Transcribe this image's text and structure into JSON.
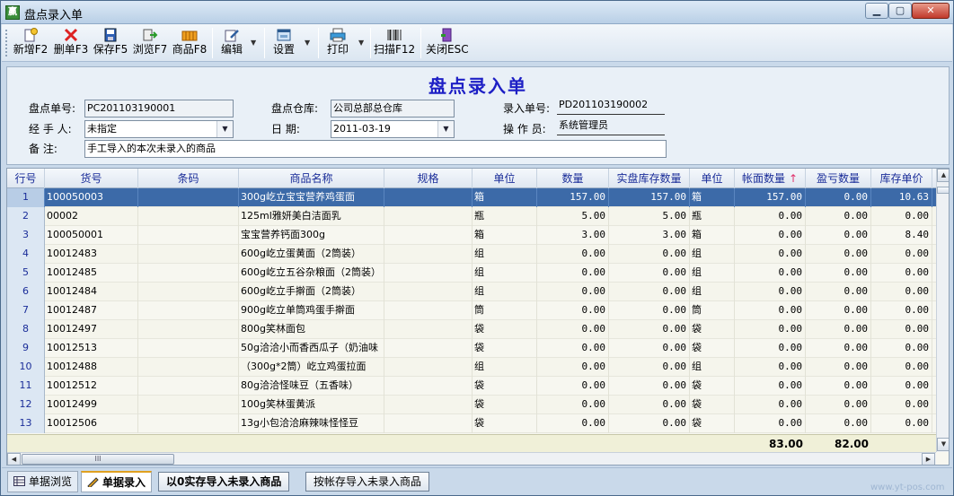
{
  "window": {
    "title": "盘点录入单",
    "icon_text": "赢"
  },
  "toolbar": [
    {
      "name": "add",
      "label": "新增F2",
      "icon": "new-doc-icon"
    },
    {
      "name": "delete",
      "label": "删单F3",
      "icon": "delete-x-icon"
    },
    {
      "name": "save",
      "label": "保存F5",
      "icon": "save-disk-icon"
    },
    {
      "name": "browse",
      "label": "浏览F7",
      "icon": "browse-arrow-icon"
    },
    {
      "name": "product",
      "label": "商品F8",
      "icon": "product-box-icon"
    },
    {
      "name": "edit",
      "label": "编辑",
      "icon": "edit-pen-icon"
    },
    {
      "name": "settings",
      "label": "设置",
      "icon": "settings-window-icon"
    },
    {
      "name": "print",
      "label": "打印",
      "icon": "printer-icon"
    },
    {
      "name": "scan",
      "label": "扫描F12",
      "icon": "barcode-icon"
    },
    {
      "name": "close",
      "label": "关闭ESC",
      "icon": "close-door-icon"
    }
  ],
  "form": {
    "title": "盘点录入单",
    "doc_no_label": "盘点单号:",
    "doc_no": "PC201103190001",
    "handler_label": "经 手 人:",
    "handler": "未指定",
    "note_label": "备    注:",
    "note": "手工导入的本次未录入的商品",
    "warehouse_label": "盘点仓库:",
    "warehouse": "公司总部总仓库",
    "date_label": "日    期:",
    "date": "2011-03-19",
    "entry_no_label": "录入单号:",
    "entry_no": "PD201103190002",
    "operator_label": "操 作 员:",
    "operator": "系统管理员"
  },
  "grid": {
    "columns": [
      "行号",
      "货号",
      "条码",
      "商品名称",
      "规格",
      "单位",
      "数量",
      "实盘库存数量",
      "单位",
      "帐面数量",
      "盈亏数量",
      "库存单价"
    ],
    "sort_indicator": "↑",
    "rows": [
      {
        "no": "1",
        "code": "100050003",
        "barcode": "",
        "name": "300g屹立宝宝营养鸡蛋面",
        "spec": "",
        "unit": "箱",
        "qty": "157.00",
        "actual": "157.00",
        "unit2": "箱",
        "book": "157.00",
        "diff": "0.00",
        "price": "10.63"
      },
      {
        "no": "2",
        "code": "00002",
        "barcode": "",
        "name": "125ml雅妍美白洁面乳",
        "spec": "",
        "unit": "瓶",
        "qty": "5.00",
        "actual": "5.00",
        "unit2": "瓶",
        "book": "0.00",
        "diff": "0.00",
        "price": "0.00"
      },
      {
        "no": "3",
        "code": "100050001",
        "barcode": "",
        "name": "宝宝营养钙面300g",
        "spec": "",
        "unit": "箱",
        "qty": "3.00",
        "actual": "3.00",
        "unit2": "箱",
        "book": "0.00",
        "diff": "0.00",
        "price": "8.40"
      },
      {
        "no": "4",
        "code": "10012483",
        "barcode": "",
        "name": "600g屹立蛋黄面（2筒装）",
        "spec": "",
        "unit": "组",
        "qty": "0.00",
        "actual": "0.00",
        "unit2": "组",
        "book": "0.00",
        "diff": "0.00",
        "price": "0.00"
      },
      {
        "no": "5",
        "code": "10012485",
        "barcode": "",
        "name": "600g屹立五谷杂粮面（2筒装）",
        "spec": "",
        "unit": "组",
        "qty": "0.00",
        "actual": "0.00",
        "unit2": "组",
        "book": "0.00",
        "diff": "0.00",
        "price": "0.00"
      },
      {
        "no": "6",
        "code": "10012484",
        "barcode": "",
        "name": "600g屹立手擀面（2筒装）",
        "spec": "",
        "unit": "组",
        "qty": "0.00",
        "actual": "0.00",
        "unit2": "组",
        "book": "0.00",
        "diff": "0.00",
        "price": "0.00"
      },
      {
        "no": "7",
        "code": "10012487",
        "barcode": "",
        "name": "900g屹立单筒鸡蛋手擀面",
        "spec": "",
        "unit": "筒",
        "qty": "0.00",
        "actual": "0.00",
        "unit2": "筒",
        "book": "0.00",
        "diff": "0.00",
        "price": "0.00"
      },
      {
        "no": "8",
        "code": "10012497",
        "barcode": "",
        "name": "800g笑林面包",
        "spec": "",
        "unit": "袋",
        "qty": "0.00",
        "actual": "0.00",
        "unit2": "袋",
        "book": "0.00",
        "diff": "0.00",
        "price": "0.00"
      },
      {
        "no": "9",
        "code": "10012513",
        "barcode": "",
        "name": "50g洽洽小而香西瓜子（奶油味",
        "spec": "",
        "unit": "袋",
        "qty": "0.00",
        "actual": "0.00",
        "unit2": "袋",
        "book": "0.00",
        "diff": "0.00",
        "price": "0.00"
      },
      {
        "no": "10",
        "code": "10012488",
        "barcode": "",
        "name": "（300g*2筒）屹立鸡蛋拉面",
        "spec": "",
        "unit": "组",
        "qty": "0.00",
        "actual": "0.00",
        "unit2": "组",
        "book": "0.00",
        "diff": "0.00",
        "price": "0.00"
      },
      {
        "no": "11",
        "code": "10012512",
        "barcode": "",
        "name": "80g洽洽怪味豆（五香味）",
        "spec": "",
        "unit": "袋",
        "qty": "0.00",
        "actual": "0.00",
        "unit2": "袋",
        "book": "0.00",
        "diff": "0.00",
        "price": "0.00"
      },
      {
        "no": "12",
        "code": "10012499",
        "barcode": "",
        "name": "100g笑林蛋黄派",
        "spec": "",
        "unit": "袋",
        "qty": "0.00",
        "actual": "0.00",
        "unit2": "袋",
        "book": "0.00",
        "diff": "0.00",
        "price": "0.00"
      },
      {
        "no": "13",
        "code": "10012506",
        "barcode": "",
        "name": "13g小包洽洽麻辣味怪怪豆",
        "spec": "",
        "unit": "袋",
        "qty": "0.00",
        "actual": "0.00",
        "unit2": "袋",
        "book": "0.00",
        "diff": "0.00",
        "price": "0.00"
      }
    ],
    "totals": {
      "book": "83.00",
      "diff": "82.00"
    },
    "hscroll_thumb": "III"
  },
  "tabs": {
    "browse": "单据浏览",
    "entry": "单据录入",
    "import_zero": "以0实存导入未录入商品",
    "import_book": "按帐存导入未录入商品"
  },
  "watermark": "www.yt-pos.com"
}
